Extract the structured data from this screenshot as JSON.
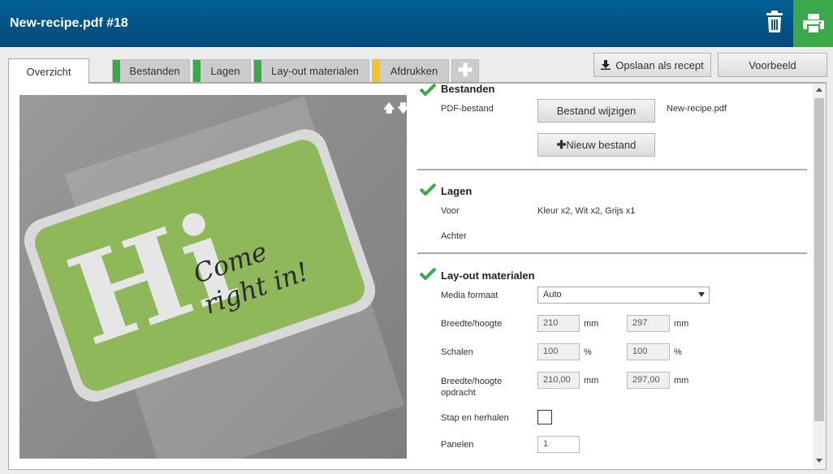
{
  "header": {
    "title": "New-recipe.pdf #18",
    "trash_icon": "trash-icon",
    "print_icon": "printer-icon",
    "print_bg": "#3ba94a",
    "bg": "#035f96"
  },
  "tabs": [
    {
      "label": "Overzicht",
      "active": true
    },
    {
      "label": "Bestanden",
      "status_color": "#3ba94a"
    },
    {
      "label": "Lagen",
      "status_color": "#3ba94a"
    },
    {
      "label": "Lay-out materialen",
      "status_color": "#3ba94a"
    },
    {
      "label": "Afdrukken",
      "status_color": "#f5c518"
    }
  ],
  "add_tab_icon": "plus-icon",
  "toolbar": {
    "save_recipe_label": "Opslaan als recept",
    "save_recipe_icon": "download-icon",
    "preview_label": "Voorbeeld"
  },
  "preview": {
    "arrows_label": "🡅🡇",
    "hi_text": "Hi",
    "tag_line1": "Come",
    "tag_line2": "right in!"
  },
  "sections": {
    "files": {
      "title": "Bestanden",
      "pdf_label": "PDF-bestand",
      "change_button": "Bestand wijzigen",
      "filename": "New-recipe.pdf",
      "new_file_button": "Nieuw bestand"
    },
    "layers": {
      "title": "Lagen",
      "front_label": "Voor",
      "front_value": "Kleur x2, Wit x2, Grijs x1",
      "back_label": "Achter"
    },
    "layout": {
      "title": "Lay-out materialen",
      "media_label": "Media formaat",
      "media_value": "Auto",
      "size_label": "Breedte/hoogte",
      "width": "210",
      "height": "297",
      "unit_mm": "mm",
      "scale_label": "Schalen",
      "scale_w": "100",
      "scale_h": "100",
      "unit_pct": "%",
      "job_size_label": "Breedte/hoogte opdracht",
      "job_w": "210,00",
      "job_h": "297,00",
      "step_repeat_label": "Stap en herhalen",
      "step_repeat_checked": false,
      "panels_label": "Panelen",
      "panels_value": "1"
    }
  }
}
